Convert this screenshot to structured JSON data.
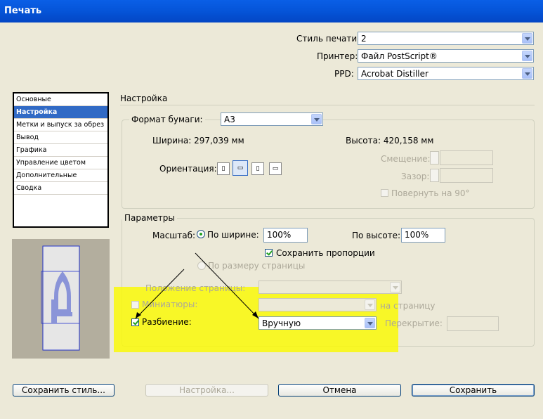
{
  "window": {
    "title": "Печать"
  },
  "top_fields": {
    "style_label": "Стиль печати:",
    "style_value": "2",
    "printer_label": "Принтер:",
    "printer_value": "Файл PostScript®",
    "ppd_label": "PPD:",
    "ppd_value": "Acrobat Distiller"
  },
  "sidebar": {
    "items": [
      {
        "label": "Основные",
        "selected": false
      },
      {
        "label": "Настройка",
        "selected": true
      },
      {
        "label": "Метки и выпуск за обрез",
        "selected": false
      },
      {
        "label": "Вывод",
        "selected": false
      },
      {
        "label": "Графика",
        "selected": false
      },
      {
        "label": "Управление цветом",
        "selected": false
      },
      {
        "label": "Дополнительные",
        "selected": false
      },
      {
        "label": "Сводка",
        "selected": false
      }
    ]
  },
  "section_title": "Настройка",
  "paper": {
    "format_label": "Формат бумаги:",
    "format_value": "A3",
    "width_label": "Ширина: 297,039 мм",
    "height_label": "Высота: 420,158 мм",
    "orientation_label": "Ориентация:",
    "offset_label": "Смещение:",
    "gap_label": "Зазор:",
    "rotate_label": "Повернуть на 90°"
  },
  "params": {
    "group_label": "Параметры",
    "scale_label": "Масштаб:",
    "by_width_label": "По ширине:",
    "by_width_value": "100%",
    "by_height_label": "По высоте:",
    "by_height_value": "100%",
    "keep_proportions_label": "Сохранить пропорции",
    "fit_page_label": "По размеру страницы",
    "page_position_label": "Положение страницы:",
    "thumbnails_label": "Миниатюры:",
    "per_page_label": "на страницу",
    "tiling_label": "Разбиение:",
    "tiling_value": "Вручную",
    "overlap_label": "Перекрытие:"
  },
  "buttons": {
    "save_style": "Сохранить стиль...",
    "setup": "Настройка...",
    "cancel": "Отмена",
    "save": "Сохранить"
  },
  "colors": {
    "highlight": "#fafa00",
    "title_bar": "#0554d8",
    "selection": "#316ac5"
  }
}
